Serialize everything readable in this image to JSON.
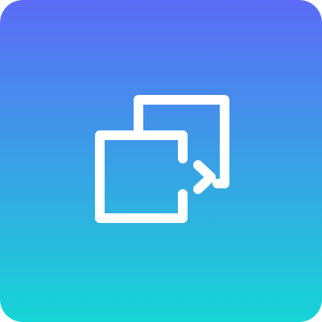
{
  "icon": {
    "name": "switch-window-icon",
    "gradient_top": "#5C6BF6",
    "gradient_bottom": "#16D5D6",
    "stroke_color": "#FFFFFF"
  }
}
